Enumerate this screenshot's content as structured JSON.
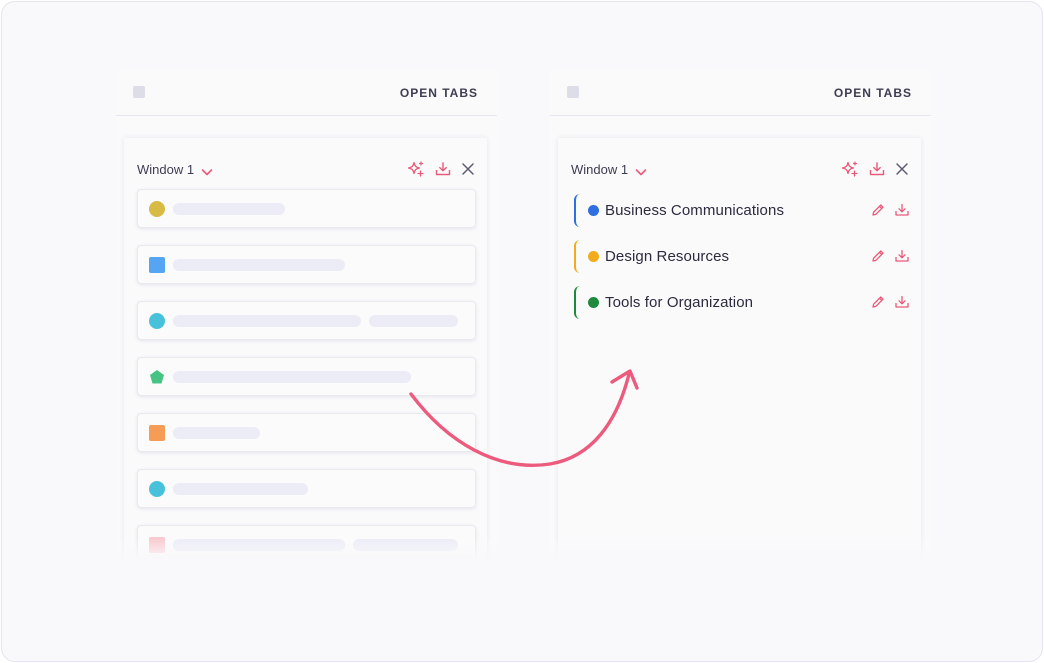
{
  "colors": {
    "accent": "#e95a7a",
    "text_dark": "#2b2b3f",
    "placeholder": "#ebecf6"
  },
  "left_panel": {
    "title": "OPEN TABS",
    "window_label": "Window 1",
    "icons": [
      "sparkle-icon",
      "download-icon",
      "close-icon"
    ],
    "tabs": [
      {
        "icon": "yellow-circle",
        "color": "#d7bb45"
      },
      {
        "icon": "blue-square",
        "color": "#56a5f3"
      },
      {
        "icon": "cyan-circle",
        "color": "#48c2db"
      },
      {
        "icon": "green-pentagon",
        "color": "#47c483"
      },
      {
        "icon": "orange-square",
        "color": "#f59c56"
      },
      {
        "icon": "cyan-circle",
        "color": "#48c2db"
      },
      {
        "icon": "pink-square",
        "color": "#f8c9cf"
      }
    ]
  },
  "right_panel": {
    "title": "OPEN TABS",
    "window_label": "Window 1",
    "icons": [
      "sparkle-icon",
      "download-icon",
      "close-icon"
    ],
    "groups": [
      {
        "title": "Business Communications",
        "color": "#2f6fe0"
      },
      {
        "title": "Design Resources",
        "color": "#f2ab1b"
      },
      {
        "title": "Tools for Organization",
        "color": "#1f8a3d"
      }
    ]
  }
}
